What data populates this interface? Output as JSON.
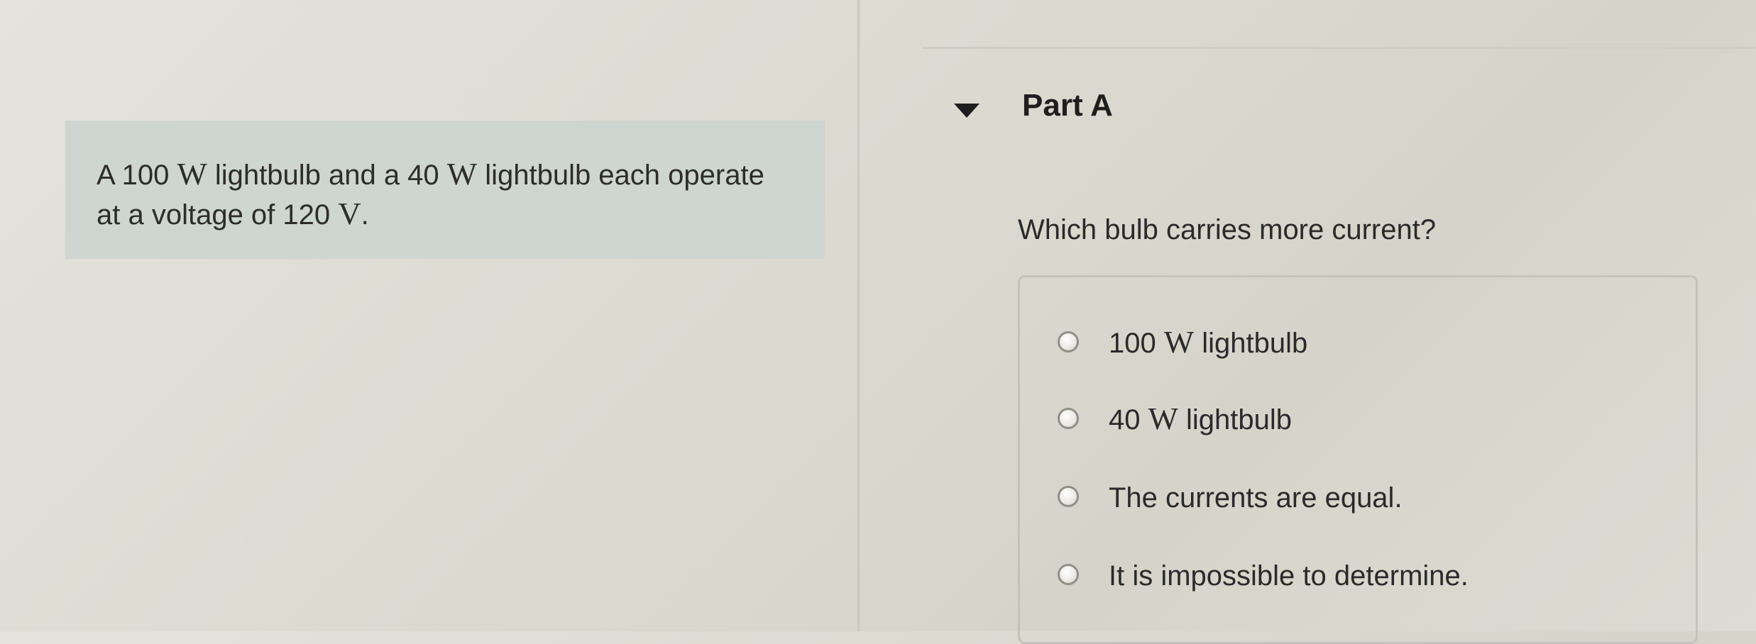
{
  "problem": {
    "parts": [
      "A 100 ",
      "W",
      " lightbulb and a 40 ",
      "W",
      " lightbulb each operate at a voltage of 120 ",
      "V",
      "."
    ]
  },
  "part": {
    "title": "Part A",
    "question": "Which bulb carries more current?",
    "options": [
      {
        "pre": "100 ",
        "unit": "W",
        "post": " lightbulb"
      },
      {
        "pre": "40 ",
        "unit": "W",
        "post": " lightbulb"
      },
      {
        "pre": "",
        "unit": "",
        "post": "The currents are equal."
      },
      {
        "pre": "",
        "unit": "",
        "post": "It is impossible to determine."
      }
    ]
  },
  "icons": {
    "collapse": "caret-down-icon",
    "option": "radio-button"
  },
  "colors": {
    "problem_background": "#cfd5d0",
    "page_background": "#dddbd3",
    "text": "#2a2a2a"
  }
}
